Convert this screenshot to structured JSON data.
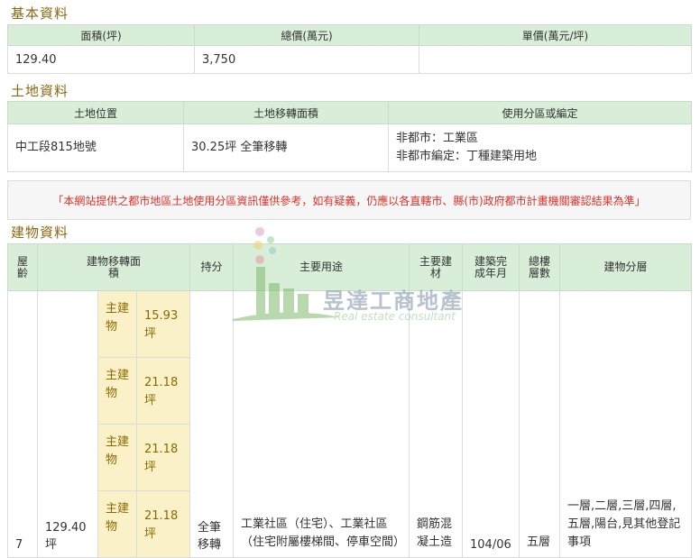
{
  "basic": {
    "title": "基本資料",
    "headers": [
      "面積(坪)",
      "總價(萬元)",
      "單價(萬元/坪)"
    ],
    "values": [
      "129.40",
      "3,750",
      ""
    ]
  },
  "land": {
    "title": "土地資料",
    "headers": [
      "土地位置",
      "土地移轉面積",
      "使用分區或編定"
    ],
    "location": "中工段815地號",
    "area": "30.25坪 全筆移轉",
    "zoning_line1": "非都市：工業區",
    "zoning_line2": "非都市編定：丁種建築用地"
  },
  "notice": "「本網站提供之都市地區土地使用分區資訊僅供參考，如有疑義，仍應以各直轄市、縣(市)政府都市計畫機關審認結果為準」",
  "building": {
    "title": "建物資料",
    "headers": {
      "age": "屋齡",
      "area": "建物移轉面積",
      "share": "持分",
      "use": "主要用途",
      "material": "主要建材",
      "completed": "建築完成年月",
      "floors": "總樓層數",
      "levels": "建物分層"
    },
    "row": {
      "age": "7",
      "area": "129.40坪",
      "share": "全筆移轉",
      "use": "工業社區（住宅）、工業社區（住宅附屬樓梯間、停車空間）",
      "material": "鋼筋混凝土造",
      "completed": "104/06",
      "floors": "五層",
      "levels": "一層,二層,三層,四層,五層,陽台,見其他登記事項"
    },
    "sub_rows": [
      {
        "label": "主建物",
        "value": "15.93坪"
      },
      {
        "label": "主建物",
        "value": "21.18坪"
      },
      {
        "label": "主建物",
        "value": "21.18坪"
      },
      {
        "label": "主建物",
        "value": "21.18坪"
      }
    ]
  },
  "watermark": {
    "name": "昱達工商地產",
    "tagline": "Real estate consultant"
  }
}
